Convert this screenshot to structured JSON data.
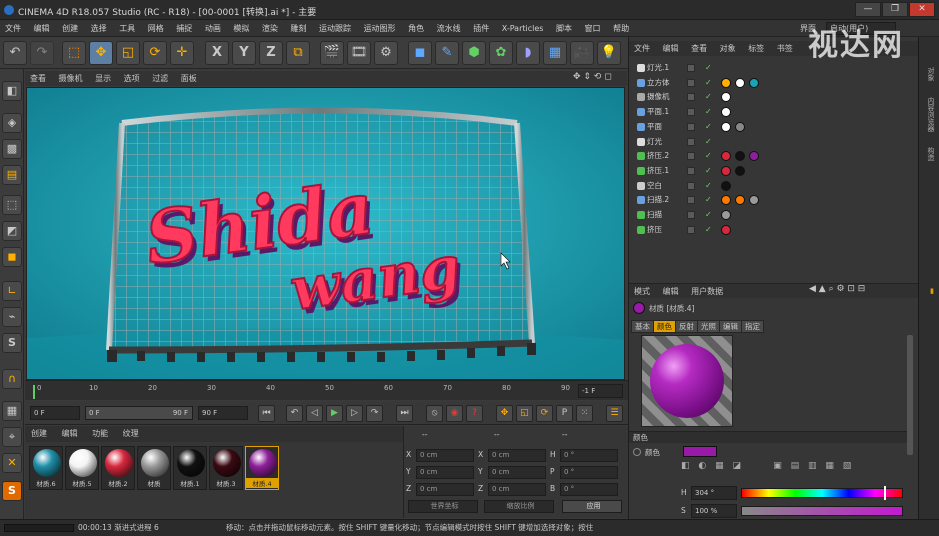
{
  "window": {
    "title": "CINEMA 4D R18.057 Studio (RC - R18) - [00-0001 [转换].ai *] - 主要",
    "buttons": [
      "—",
      "❐",
      "✕"
    ]
  },
  "menubar": [
    "文件",
    "编辑",
    "创建",
    "选择",
    "工具",
    "网格",
    "捕捉",
    "动画",
    "模拟",
    "渲染",
    "雕刻",
    "运动跟踪",
    "运动图形",
    "角色",
    "流水线",
    "插件",
    "X-Particles",
    "脚本",
    "窗口",
    "帮助"
  ],
  "layout_label": "界面",
  "layout_value": "启动(用户)",
  "toolbar_icons": [
    "undo-icon",
    "redo-icon",
    "live-select-icon",
    "move-icon",
    "scale-icon",
    "rotate-icon",
    "recent-tool-icon",
    "x-axis-icon",
    "y-axis-icon",
    "z-axis-icon",
    "world-coord-icon",
    "render-view-icon",
    "render-picture-viewer-icon",
    "render-settings-icon",
    "cube-icon",
    "pen-icon",
    "subdivision-icon",
    "mograph-cloner-icon",
    "deformer-icon",
    "environment-icon",
    "camera-icon",
    "light-icon"
  ],
  "axis_labels": [
    "X",
    "Y",
    "Z"
  ],
  "viewport": {
    "menu": [
      "查看",
      "摄像机",
      "显示",
      "选项",
      "过滤",
      "面板"
    ],
    "scene_text_line1": "Shida",
    "scene_text_line2": "wang"
  },
  "timeline": {
    "ticks": [
      "0",
      "10",
      "20",
      "30",
      "40",
      "50",
      "60",
      "70",
      "80",
      "90"
    ],
    "current_frame_field": "-1 F"
  },
  "transport": {
    "start": "0 F",
    "min": "0 F",
    "max": "90 F",
    "end": "90 F"
  },
  "materials": {
    "menu": [
      "创建",
      "编辑",
      "功能",
      "纹理"
    ],
    "items": [
      {
        "name": "材质.6",
        "color": "#1f8fa8"
      },
      {
        "name": "材质.5",
        "color": "#f4f4f4"
      },
      {
        "name": "材质.2",
        "color": "#d8283e"
      },
      {
        "name": "材质",
        "color": "#9a9a9a"
      },
      {
        "name": "材质.1",
        "color": "#111111"
      },
      {
        "name": "材质.3",
        "color": "#3a0a12"
      },
      {
        "name": "材质.4",
        "color": "#8e1f9a"
      }
    ],
    "active_index": 6
  },
  "coords": {
    "headers": [
      "--",
      "--",
      "--"
    ],
    "rows": [
      {
        "a": "X",
        "av": "0 cm",
        "b": "X",
        "bv": "0 cm",
        "c": "H",
        "cv": "0 °"
      },
      {
        "a": "Y",
        "av": "0 cm",
        "b": "Y",
        "bv": "0 cm",
        "c": "P",
        "cv": "0 °"
      },
      {
        "a": "Z",
        "av": "0 cm",
        "b": "Z",
        "bv": "0 cm",
        "c": "B",
        "cv": "0 °"
      }
    ],
    "dropdown1": "世界坐标",
    "dropdown2": "缩放比例",
    "apply": "应用"
  },
  "objects": {
    "menu": [
      "文件",
      "编辑",
      "查看",
      "对象",
      "标签",
      "书签"
    ],
    "rows": [
      {
        "name": "灯光.1",
        "icon": "#dddddd"
      },
      {
        "name": "立方体",
        "icon": "#6aa0e0"
      },
      {
        "name": "摄像机",
        "icon": "#aaaaaa"
      },
      {
        "name": "平面.1",
        "icon": "#6aa0e0"
      },
      {
        "name": "平面",
        "icon": "#6aa0e0"
      },
      {
        "name": "灯光",
        "icon": "#dddddd"
      },
      {
        "name": "挤压.2",
        "icon": "#4fc04f"
      },
      {
        "name": "挤压.1",
        "icon": "#4fc04f"
      },
      {
        "name": "空白",
        "icon": "#cccccc"
      },
      {
        "name": "扫描.2",
        "icon": "#6aa0e0"
      },
      {
        "name": "扫描",
        "icon": "#4fc04f"
      },
      {
        "name": "挤压",
        "icon": "#4fc04f"
      }
    ]
  },
  "attributes": {
    "menu": [
      "模式",
      "编辑",
      "用户数据"
    ],
    "material_label": "材质 [材质.4]",
    "subtabs": [
      "基本",
      "颜色",
      "反射",
      "光照",
      "编辑",
      "指定"
    ],
    "active_subtab": 1,
    "section": "颜色",
    "color_label": "颜色",
    "color_value": "#9a1aa8",
    "H_label": "H",
    "H_value": "304 °",
    "S_label": "S",
    "S_value": "100 %"
  },
  "sidetabs": [
    "对象",
    "内容浏览器",
    "构造"
  ],
  "watermark": "视达网",
  "status": {
    "time": "00:00:13 渐进式进程 6",
    "message": "移动：点击并拖动鼠标移动元素。按住 SHIFT 键量化移动；节点编辑模式时按住 SHIFT 键增加选择对象；按住"
  }
}
